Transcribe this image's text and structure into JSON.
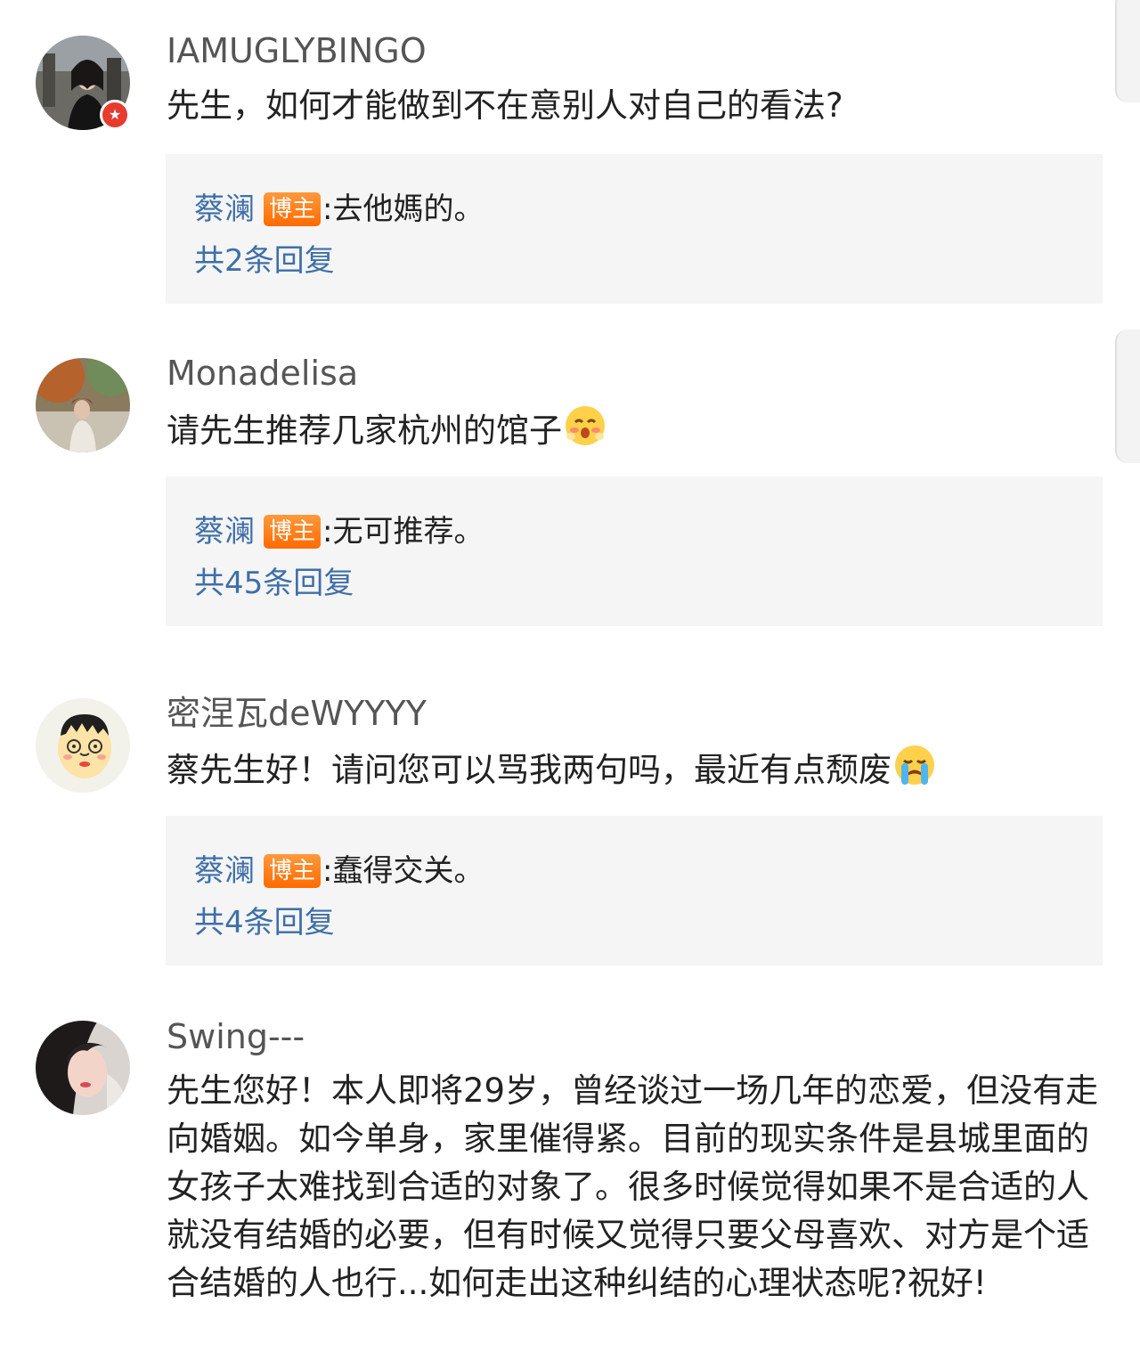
{
  "comments": [
    {
      "username": "IAMUGLYBINGO",
      "text": "先生，如何才能做到不在意别人对自己的看法?",
      "reply": {
        "author": "蔡澜",
        "badge": "博主",
        "separator": ":",
        "text": " 去他媽的。",
        "count": "共2条回复"
      }
    },
    {
      "username": "Monadelisa",
      "text": "请先生推荐几家杭州的馆子",
      "reply": {
        "author": "蔡澜",
        "badge": "博主",
        "separator": ":",
        "text": " 无可推荐。",
        "count": "共45条回复"
      }
    },
    {
      "username": "密涅瓦deWYYYY",
      "text": "蔡先生好！请问您可以骂我两句吗，最近有点颓废",
      "reply": {
        "author": "蔡澜",
        "badge": "博主",
        "separator": ":",
        "text": " 蠢得交关。",
        "count": "共4条回复"
      }
    },
    {
      "username": "Swing---",
      "text": "先生您好！本人即将29岁，曾经谈过一场几年的恋爱，但没有走向婚姻。如今单身，家里催得紧。目前的现实条件是县城里面的女孩子太难找到合适的对象了。很多时候觉得如果不是合适的人就没有结婚的必要，但有时候又觉得只要父母喜欢、对方是个适合结婚的人也行...如何走出这种纠结的心理状态呢?祝好!"
    }
  ],
  "emojis": [
    "blush-emoji",
    "crying-emoji"
  ],
  "colors": {
    "link": "#3e6fa8",
    "badge": "#ff7a12",
    "reply_bg": "#f5f5f5"
  }
}
